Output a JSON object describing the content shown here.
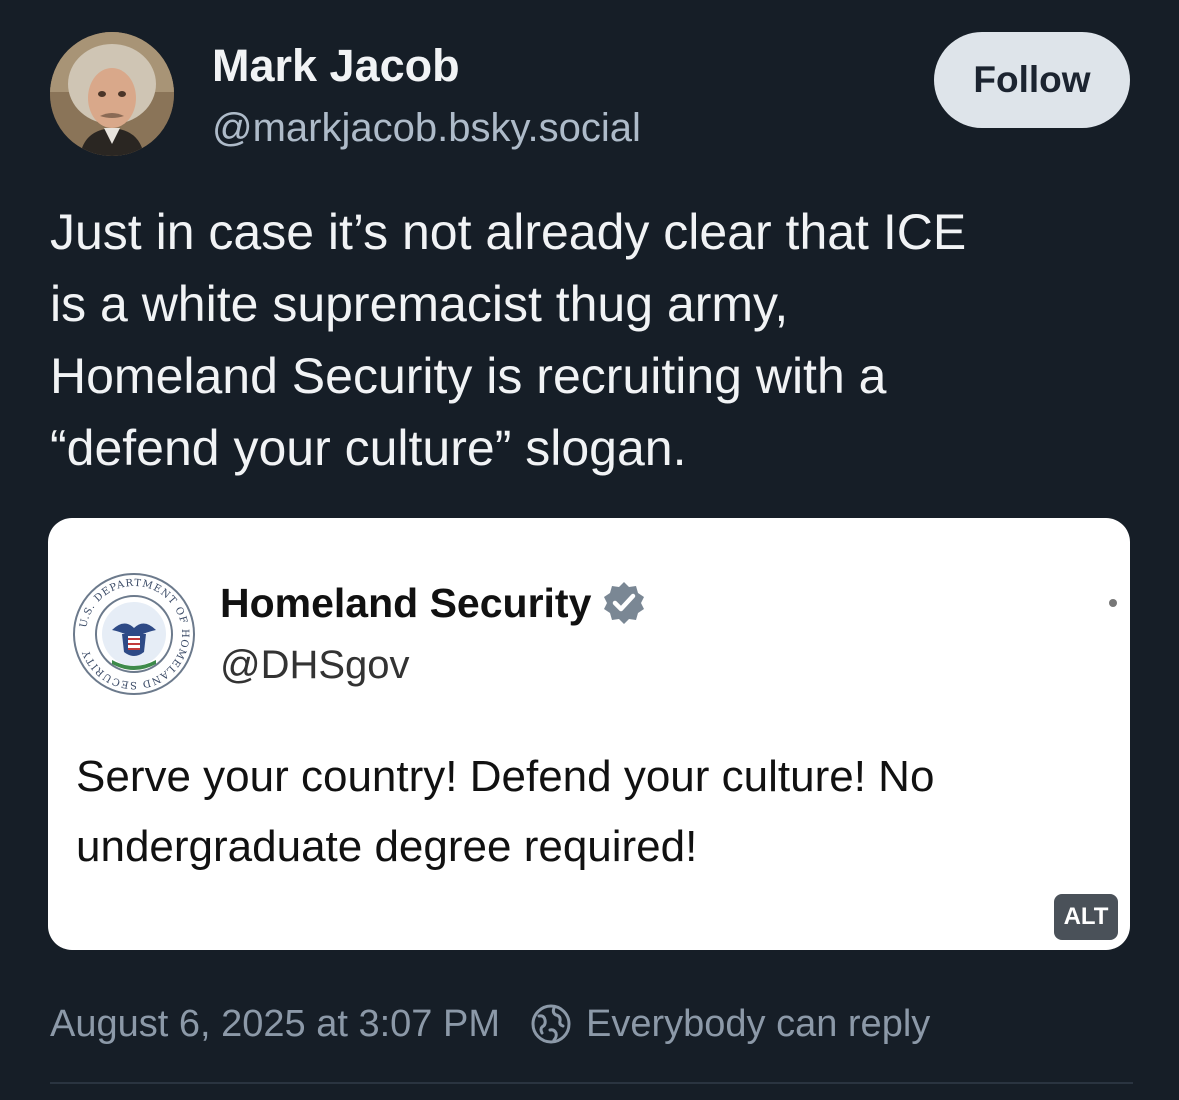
{
  "author": {
    "name": "Mark Jacob",
    "handle": "@markjacob.bsky.social"
  },
  "follow_button": {
    "label": "Follow"
  },
  "post": {
    "text_lines": [
      "Just in case it’s not already clear that ICE",
      "is a white supremacist thug army,",
      "Homeland Security is recruiting with a",
      "“defend your culture” slogan."
    ]
  },
  "embed": {
    "author_name": "Homeland Security",
    "author_handle": "@DHSgov",
    "verified": true,
    "text_lines": [
      "Serve your country! Defend your culture! No",
      "undergraduate degree required!"
    ],
    "alt_label": "ALT",
    "seal_lettering": "U.S. DEPARTMENT OF HOMELAND SECURITY"
  },
  "meta": {
    "timestamp": "August 6, 2025 at 3:07 PM",
    "reply_setting": "Everybody can reply"
  },
  "colors": {
    "background": "#161e27",
    "follow_button": "#dee4ea",
    "secondary_text": "#8c99a8",
    "verified_badge": "#7a8794"
  },
  "icons": {
    "verified": "verified-badge-icon",
    "reply_setting": "globe-icon",
    "more": "more-icon"
  }
}
